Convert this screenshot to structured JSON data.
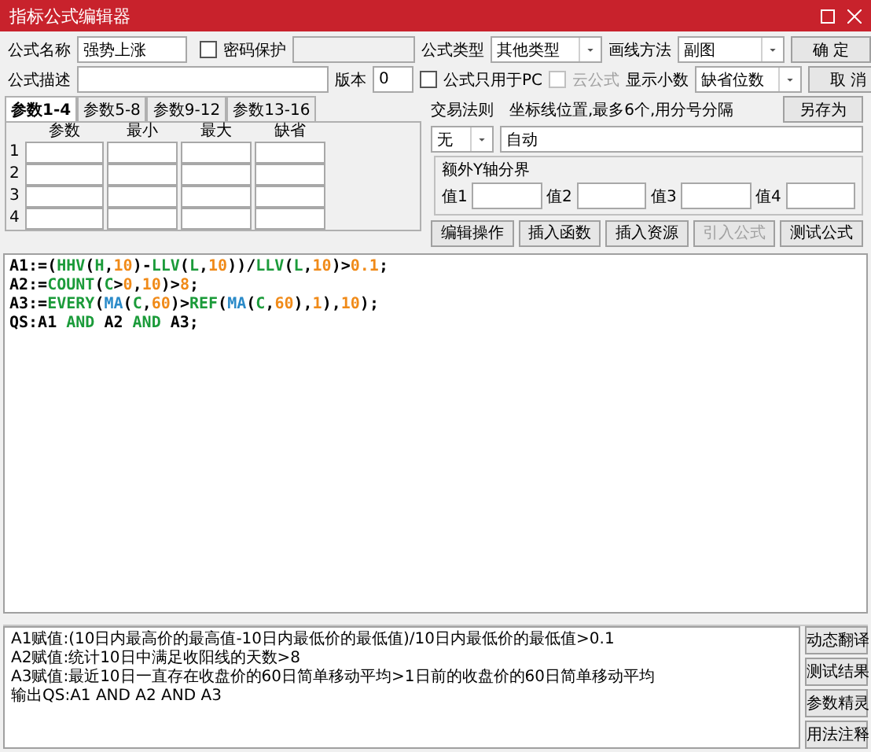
{
  "window": {
    "title": "指标公式编辑器"
  },
  "form": {
    "name_label": "公式名称",
    "name_value": "强势上涨",
    "password": {
      "label": "密码保护",
      "checked": false
    },
    "type_label": "公式类型",
    "type_value": "其他类型",
    "draw_label": "画线方法",
    "draw_value": "副图",
    "desc_label": "公式描述",
    "version_label": "版本",
    "version_value": "0",
    "pc_only": {
      "label": "公式只用于PC",
      "checked": false
    },
    "cloud": {
      "label": "云公式",
      "checked": false,
      "disabled": true
    },
    "decimals_label": "显示小数",
    "decimals_value": "缺省位数"
  },
  "buttons": [
    "确 定",
    "取 消",
    "另存为"
  ],
  "param_tabs": [
    {
      "label": "参数1-4",
      "selected": true
    },
    {
      "label": "参数5-8",
      "selected": false
    },
    {
      "label": "参数9-12",
      "selected": false
    },
    {
      "label": "参数13-16",
      "selected": false
    }
  ],
  "param_table": {
    "columns": [
      "参数",
      "最小",
      "最大",
      "缺省"
    ],
    "rows": [
      "1",
      "2",
      "3",
      "4"
    ]
  },
  "trade_rule": {
    "label": "交易法则",
    "value": "无"
  },
  "axis": {
    "label": "坐标线位置,最多6个,用分号分隔",
    "value": "自动"
  },
  "y_bounds": {
    "title": "额外Y轴分界",
    "fields": [
      "值1",
      "值2",
      "值3",
      "值4"
    ]
  },
  "actions": [
    {
      "label": "编辑操作",
      "disabled": false
    },
    {
      "label": "插入函数",
      "disabled": false
    },
    {
      "label": "插入资源",
      "disabled": false
    },
    {
      "label": "引入公式",
      "disabled": true
    },
    {
      "label": "测试公式",
      "disabled": false
    }
  ],
  "code": [
    [
      {
        "kind": "plain",
        "text": "A1:=("
      },
      {
        "kind": "func",
        "text": "HHV"
      },
      {
        "kind": "plain",
        "text": "("
      },
      {
        "kind": "var",
        "text": "H"
      },
      {
        "kind": "plain",
        "text": ","
      },
      {
        "kind": "num",
        "text": "10"
      },
      {
        "kind": "plain",
        "text": ")-"
      },
      {
        "kind": "func",
        "text": "LLV"
      },
      {
        "kind": "plain",
        "text": "("
      },
      {
        "kind": "var",
        "text": "L"
      },
      {
        "kind": "plain",
        "text": ","
      },
      {
        "kind": "num",
        "text": "10"
      },
      {
        "kind": "plain",
        "text": "))/"
      },
      {
        "kind": "func",
        "text": "LLV"
      },
      {
        "kind": "plain",
        "text": "("
      },
      {
        "kind": "var",
        "text": "L"
      },
      {
        "kind": "plain",
        "text": ","
      },
      {
        "kind": "num",
        "text": "10"
      },
      {
        "kind": "plain",
        "text": ")>"
      },
      {
        "kind": "num",
        "text": "0.1"
      },
      {
        "kind": "plain",
        "text": ";"
      }
    ],
    [
      {
        "kind": "plain",
        "text": "A2:="
      },
      {
        "kind": "func",
        "text": "COUNT"
      },
      {
        "kind": "plain",
        "text": "("
      },
      {
        "kind": "var",
        "text": "C"
      },
      {
        "kind": "plain",
        "text": ">"
      },
      {
        "kind": "num",
        "text": "0"
      },
      {
        "kind": "plain",
        "text": ","
      },
      {
        "kind": "num",
        "text": "10"
      },
      {
        "kind": "plain",
        "text": ")>"
      },
      {
        "kind": "num",
        "text": "8"
      },
      {
        "kind": "plain",
        "text": ";"
      }
    ],
    [
      {
        "kind": "plain",
        "text": "A3:="
      },
      {
        "kind": "func",
        "text": "EVERY"
      },
      {
        "kind": "plain",
        "text": "("
      },
      {
        "kind": "func2",
        "text": "MA"
      },
      {
        "kind": "plain",
        "text": "("
      },
      {
        "kind": "var",
        "text": "C"
      },
      {
        "kind": "plain",
        "text": ","
      },
      {
        "kind": "num",
        "text": "60"
      },
      {
        "kind": "plain",
        "text": ")>"
      },
      {
        "kind": "func",
        "text": "REF"
      },
      {
        "kind": "plain",
        "text": "("
      },
      {
        "kind": "func2",
        "text": "MA"
      },
      {
        "kind": "plain",
        "text": "("
      },
      {
        "kind": "var",
        "text": "C"
      },
      {
        "kind": "plain",
        "text": ","
      },
      {
        "kind": "num",
        "text": "60"
      },
      {
        "kind": "plain",
        "text": "),"
      },
      {
        "kind": "num",
        "text": "1"
      },
      {
        "kind": "plain",
        "text": "),"
      },
      {
        "kind": "num",
        "text": "10"
      },
      {
        "kind": "plain",
        "text": ");"
      }
    ],
    [
      {
        "kind": "plain",
        "text": "QS:A1 "
      },
      {
        "kind": "keyword",
        "text": "AND"
      },
      {
        "kind": "plain",
        "text": " A2 "
      },
      {
        "kind": "keyword",
        "text": "AND"
      },
      {
        "kind": "plain",
        "text": " A3;"
      }
    ]
  ],
  "translation": [
    "A1赋值:(10日内最高价的最高值-10日内最低价的最低值)/10日内最低价的最低值>0.1",
    "A2赋值:统计10日中满足收阳线的天数>8",
    "A3赋值:最近10日一直存在收盘价的60日简单移动平均>1日前的收盘价的60日简单移动平均",
    "输出QS:A1 AND A2 AND A3"
  ],
  "side_buttons": [
    "动态翻译",
    "测试结果",
    "参数精灵",
    "用法注释"
  ]
}
